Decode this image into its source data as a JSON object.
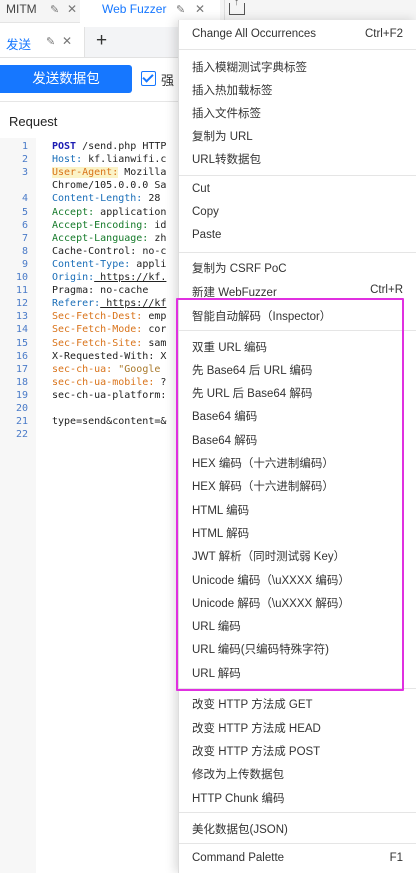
{
  "tabs": {
    "mitm_label": "MITM",
    "webfuzzer_label": "Web Fuzzer"
  },
  "subtabs": {
    "send_label": "发送"
  },
  "toolbar": {
    "send_button_label": "发送数据包",
    "checkbox_label": "强"
  },
  "request": {
    "title": "Request"
  },
  "editor": {
    "lines": [
      {
        "n": "1",
        "t": "POST /send.php HTTP"
      },
      {
        "n": "2",
        "t": "Host: kf.lianwifi.c"
      },
      {
        "n": "3",
        "t": "User-Agent: Mozilla"
      },
      {
        "n": "",
        "t": "Chrome/105.0.0.0 Sa"
      },
      {
        "n": "4",
        "t": "Content-Length: 28"
      },
      {
        "n": "5",
        "t": "Accept: application"
      },
      {
        "n": "6",
        "t": "Accept-Encoding: id"
      },
      {
        "n": "7",
        "t": "Accept-Language: zh"
      },
      {
        "n": "8",
        "t": "Cache-Control: no-c"
      },
      {
        "n": "9",
        "t": "Content-Type: appli"
      },
      {
        "n": "10",
        "t": "Origin: https://kf."
      },
      {
        "n": "11",
        "t": "Pragma: no-cache"
      },
      {
        "n": "12",
        "t": "Referer: https://kf"
      },
      {
        "n": "13",
        "t": "Sec-Fetch-Dest: emp"
      },
      {
        "n": "14",
        "t": "Sec-Fetch-Mode: cor"
      },
      {
        "n": "15",
        "t": "Sec-Fetch-Site: sam"
      },
      {
        "n": "16",
        "t": "X-Requested-With: X"
      },
      {
        "n": "17",
        "t": "sec-ch-ua: \"Google"
      },
      {
        "n": "18",
        "t": "sec-ch-ua-mobile: ?"
      },
      {
        "n": "19",
        "t": "sec-ch-ua-platform:"
      },
      {
        "n": "20",
        "t": ""
      },
      {
        "n": "21",
        "t": "type=send&content=&"
      },
      {
        "n": "22",
        "t": ""
      }
    ]
  },
  "menu": {
    "change_all": "Change All Occurrences",
    "change_all_shortcut": "Ctrl+F2",
    "insert_fuzz_dict": "插入模糊测试字典标签",
    "insert_hot_payload": "插入热加载标签",
    "insert_file_tag": "插入文件标签",
    "copy_as_url": "复制为 URL",
    "url_to_packet": "URL转数据包",
    "cut": "Cut",
    "copy": "Copy",
    "paste": "Paste",
    "copy_as_csrf": "复制为 CSRF PoC",
    "new_webfuzzer": "新建 WebFuzzer",
    "new_webfuzzer_shortcut": "Ctrl+R",
    "smart_decode": "智能自动解码（Inspector）",
    "double_url_encode": "双重 URL 编码",
    "base64_then_url": "先 Base64 后 URL 编码",
    "url_then_base64_decode": "先 URL 后 Base64 解码",
    "base64_encode": "Base64 编码",
    "base64_decode": "Base64 解码",
    "hex_encode": "HEX 编码（十六进制编码）",
    "hex_decode": "HEX 解码（十六进制解码）",
    "html_encode": "HTML 编码",
    "html_decode": "HTML 解码",
    "jwt_parse": "JWT 解析（同时测试弱 Key）",
    "unicode_encode": "Unicode 编码（\\uXXXX 编码）",
    "unicode_decode": "Unicode 解码（\\uXXXX 解码）",
    "url_encode": "URL 编码",
    "url_encode_special": "URL 编码(只编码特殊字符)",
    "url_decode": "URL 解码",
    "change_get": "改变 HTTP 方法成 GET",
    "change_head": "改变 HTTP 方法成 HEAD",
    "change_post": "改变 HTTP 方法成 POST",
    "to_upload": "修改为上传数据包",
    "chunk_encode": "HTTP Chunk 编码",
    "beautify_json": "美化数据包(JSON)",
    "command_palette": "Command Palette",
    "command_palette_shortcut": "F1"
  },
  "colors": {
    "accent": "#1677ff",
    "highlight_border": "#e030e0"
  }
}
